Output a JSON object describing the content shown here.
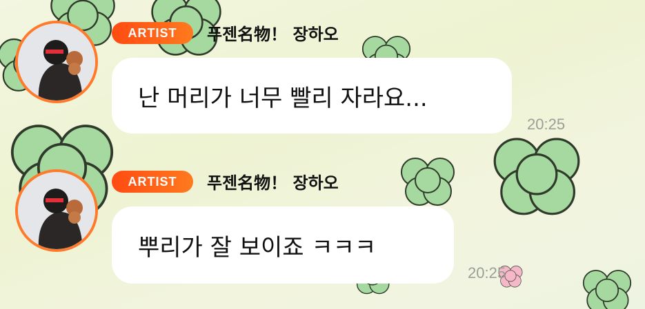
{
  "messages": [
    {
      "badge": "ARTIST",
      "sender": "푸젠名物！ 장하오",
      "text": "난 머리가 너무 빨리 자라요...",
      "time": "20:25"
    },
    {
      "badge": "ARTIST",
      "sender": "푸젠名物！ 장하오",
      "text": "뿌리가 잘 보이죠 ㅋㅋㅋ",
      "time": "20:25"
    }
  ],
  "colors": {
    "badge": "#ff5a16",
    "avatar_ring": "#ff7a2a",
    "bubble": "#ffffff",
    "time": "#9a9f96",
    "clover": "#9fd69a"
  },
  "icons": [
    "artist-badge",
    "clover-decoration",
    "avatar-photo"
  ]
}
